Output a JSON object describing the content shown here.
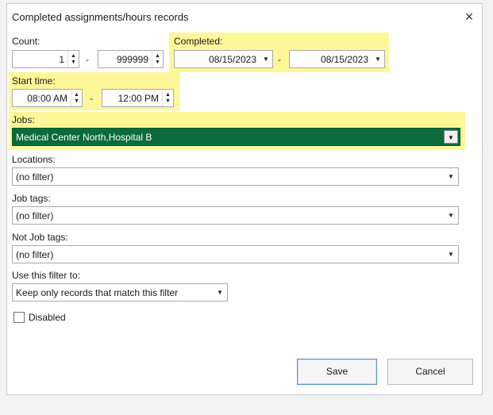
{
  "dialog": {
    "title": "Completed assignments/hours records",
    "close_symbol": "×"
  },
  "count": {
    "label": "Count:",
    "from": "1",
    "to": "999999",
    "separator": "-"
  },
  "completed": {
    "label": "Completed:",
    "from": "08/15/2023",
    "to": "08/15/2023",
    "separator": "-"
  },
  "start_time": {
    "label": "Start time:",
    "from": "08:00 AM",
    "to": "12:00 PM",
    "separator": "-"
  },
  "jobs": {
    "label": "Jobs:",
    "value": "Medical Center North,Hospital B"
  },
  "locations": {
    "label": "Locations:",
    "value": "(no filter)"
  },
  "job_tags": {
    "label": "Job tags:",
    "value": "(no filter)"
  },
  "not_job_tags": {
    "label": "Not Job tags:",
    "value": "(no filter)"
  },
  "use_filter": {
    "label": "Use this filter to:",
    "value": "Keep only records that match this filter"
  },
  "disabled": {
    "label": "Disabled",
    "checked": false
  },
  "buttons": {
    "save": "Save",
    "cancel": "Cancel"
  },
  "colors": {
    "highlight": "#fdf79a",
    "jobs_selected_bg": "#0b6b3a"
  }
}
